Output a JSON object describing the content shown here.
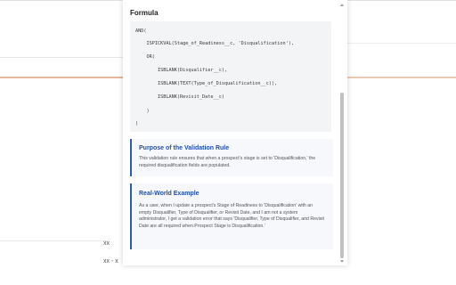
{
  "background": {
    "label_1": "xx",
    "label_2": "xx - x"
  },
  "modal": {
    "formula_heading": "Formula",
    "code_lines": [
      "AND(",
      "    ISPICKVAL(Stage_of_Readiness__c, 'Disqualification'),",
      "    OR(",
      "        ISBLANK(Disqualifier__c),",
      "        ISBLANK(TEXT(Type_of_Disqualification__c)),",
      "        ISBLANK(Revisit_Date__c)",
      "    )",
      ")"
    ],
    "purpose": {
      "title": "Purpose of the Validation Rule",
      "body": "This validation rule ensures that when a prospect's stage is set to 'Disqualification,' the required disqualification fields are populated."
    },
    "example": {
      "title": "Real-World Example",
      "body": "As a user, when I update a prospect's Stage of Readiness to 'Disqualification' with an empty Disqualifier, Type of Disqualifier, or Revisit Date, and I am not a system administrator, I get a validation error that says 'Disqualifier, Type of Disqualifier, and Revisit Date are all required when Prospect Stage is Disqualification.'"
    }
  },
  "colors": {
    "accent": "#2b5db8",
    "card_background": "#f7f8fb",
    "code_background": "#f3f4f6"
  }
}
